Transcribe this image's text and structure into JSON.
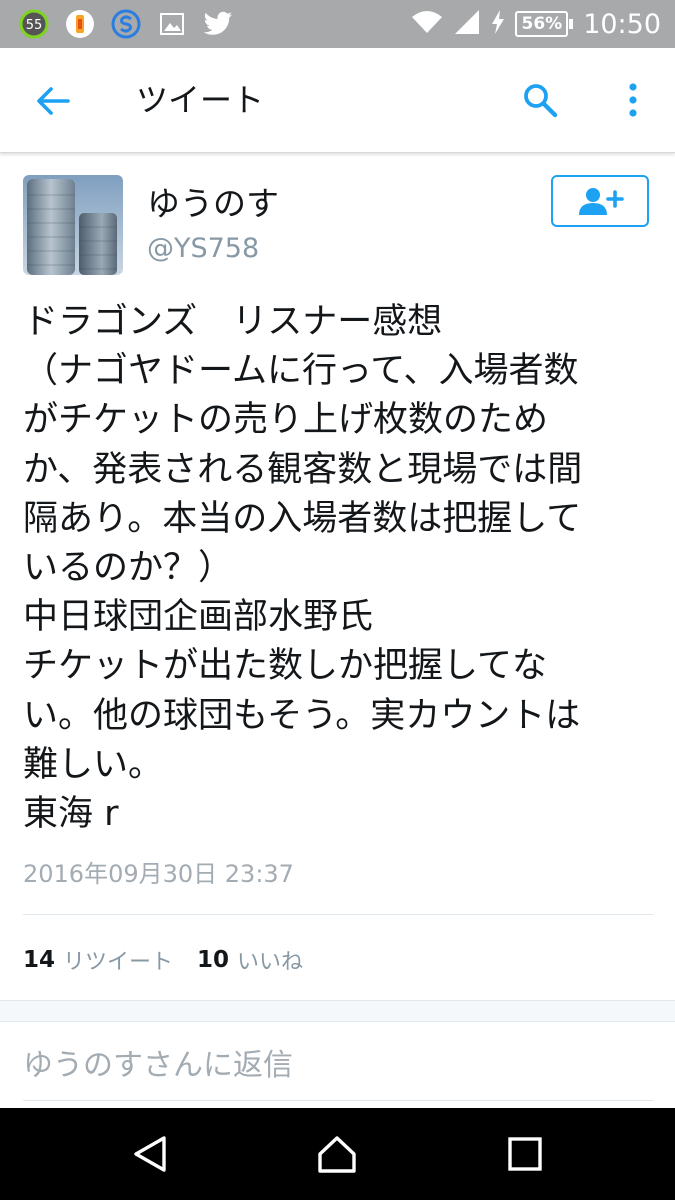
{
  "status_bar": {
    "notification_count": "55",
    "battery": "56%",
    "time": "10:50",
    "icons": [
      "badge-55-icon",
      "app-notification-icon",
      "s-app-icon",
      "image-icon",
      "twitter-bird-icon",
      "wifi-icon",
      "signal-icon",
      "charging-icon",
      "battery-icon"
    ]
  },
  "app_bar": {
    "title": "ツイート",
    "icons": [
      "back-arrow-icon",
      "search-icon",
      "more-vertical-icon"
    ],
    "accent": "#1da1f2"
  },
  "tweet": {
    "name": "ゆうのす",
    "handle": "@YS758",
    "text": "ドラゴンズ　リスナー感想\n（ナゴヤドームに行って、入場者数\nがチケットの売り上げ枚数のため\nか、発表される観客数と現場では間\n隔あり。本当の入場者数は把握して\nいるのか？）\n中日球団企画部水野氏\nチケットが出た数しか把握してな\nい。他の球団もそう。実カウントは\n難しい。\n東海 r",
    "timestamp": "2016年09月30日 23:37",
    "retweet_count": "14",
    "retweet_label": "リツイート",
    "like_count": "10",
    "like_label": "いいね"
  },
  "reply": {
    "placeholder": "ゆうのすさんに返信"
  },
  "nav_bar": {
    "icons": [
      "nav-back-icon",
      "nav-home-icon",
      "nav-recents-icon"
    ]
  }
}
